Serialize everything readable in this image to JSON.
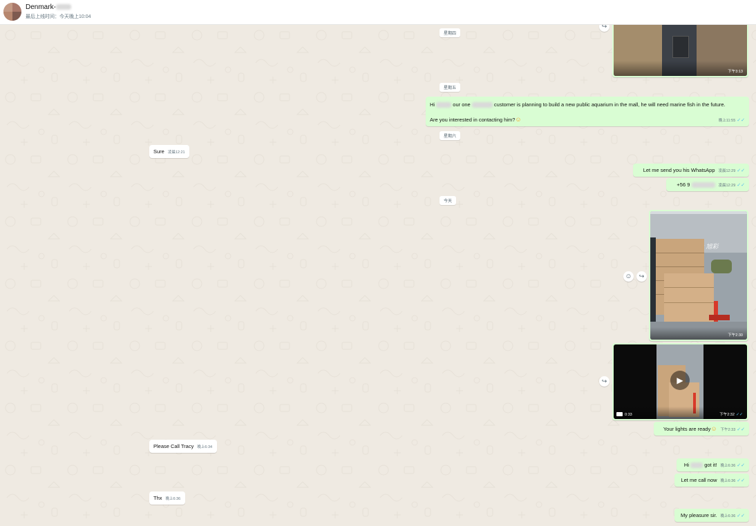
{
  "header": {
    "contact_name": "Denmark-",
    "status": "最后上线时间：今天晚上10:04"
  },
  "days": {
    "thursday": "星期四",
    "friday": "星期五",
    "saturday": "星期六",
    "today": "今天"
  },
  "icons": {
    "forward": "forward-icon",
    "emoji": "emoji-icon",
    "read": "double-check-icon",
    "play": "play-icon",
    "video": "video-icon"
  },
  "colors": {
    "outgoing": "#d9fdd3",
    "incoming": "#ffffff",
    "read_ticks": "#53bdeb",
    "wallpaper": "#efeae2"
  },
  "messages": {
    "img1_time": "下午3:13",
    "m1_part_a": "Hi",
    "m1_part_b": "our one",
    "m1_part_c": "customer is planning to build a new public aquarium in the mall, he will need marine fish in the future.",
    "m1_line2": "Are you interested in contacting him?",
    "m1_time": "晚上11:55",
    "m2_text": "Sure",
    "m2_time": "凌晨12:21",
    "m3_text": "Let me send you his WhatsApp",
    "m3_time": "凌晨12:29",
    "m4_text": "+56 9",
    "m4_time": "凌晨12:29",
    "img2_time": "下午2:30",
    "img2_wall_text": "Easy 旭彩",
    "video_duration": "0:33",
    "video_time": "下午2:32",
    "m5_text": "Your lights are ready",
    "m5_time": "下午2:33",
    "m6_text": "Please Call Tracy",
    "m6_time": "晚上6:34",
    "m7_part_a": "Hi",
    "m7_part_b": "got it!",
    "m7_time": "晚上6:36",
    "m8_text": "Let me call now",
    "m8_time": "晚上6:36",
    "m9_text": "Thx",
    "m9_time": "晚上6:36",
    "m10_text": "My pleasure sir.",
    "m10_time": "晚上6:36"
  }
}
